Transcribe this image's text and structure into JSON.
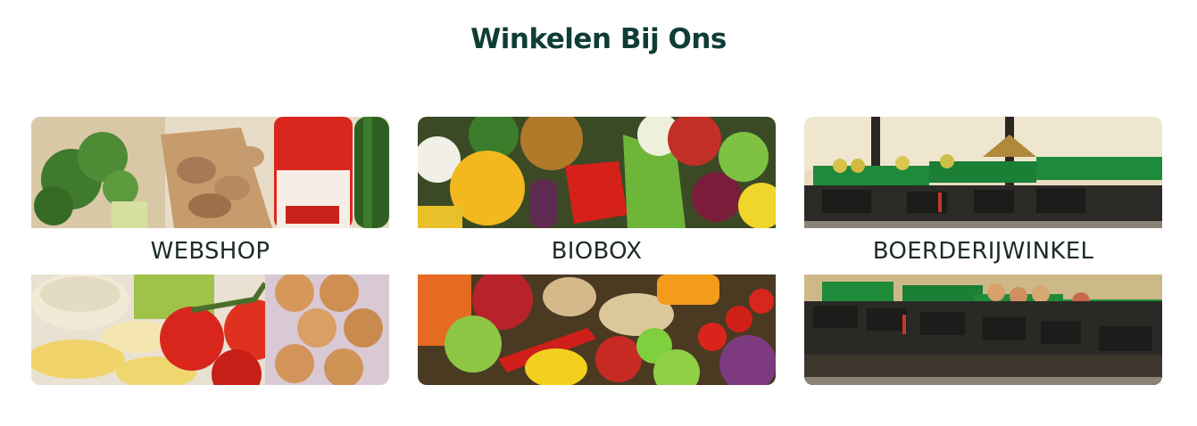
{
  "header": {
    "title": "Winkelen Bij Ons"
  },
  "cards": [
    {
      "label": "WEBSHOP",
      "image": "groceries-photo"
    },
    {
      "label": "BIOBOX",
      "image": "fruit-vegetables-photo"
    },
    {
      "label": "BOERDERIJWINKEL",
      "image": "farm-shop-shelves-photo"
    }
  ]
}
